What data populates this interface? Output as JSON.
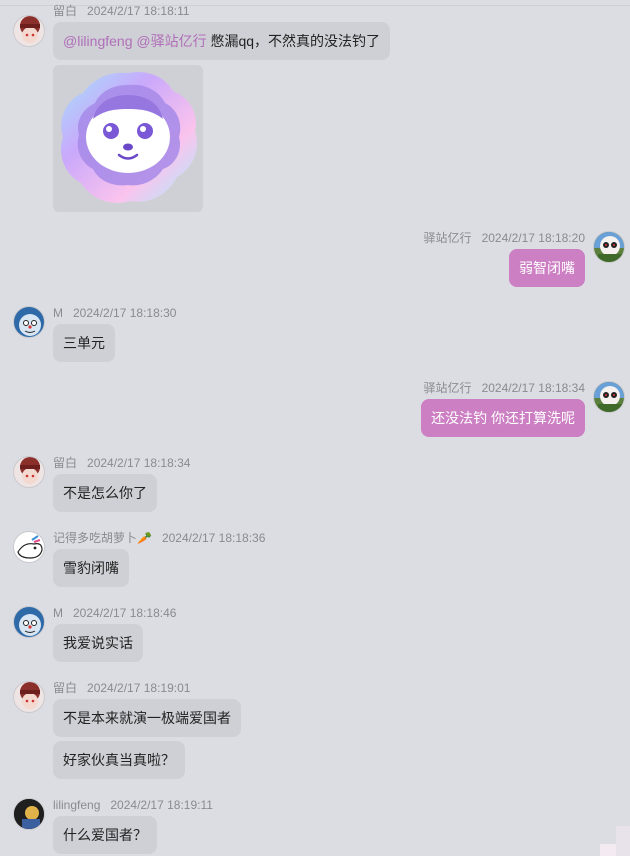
{
  "messages": [
    {
      "sender": "留白",
      "time": "2024/2/17 18:18:11",
      "mention": "@lilingfeng @驿站亿行",
      "text": "憋漏qq，不然真的没法钓了",
      "sticker": "dog-sticker"
    },
    {
      "sender": "驿站亿行",
      "time": "2024/2/17 18:18:20",
      "text": "弱智闭嘴"
    },
    {
      "sender": "M",
      "time": "2024/2/17 18:18:30",
      "text": "三单元"
    },
    {
      "sender": "驿站亿行",
      "time": "2024/2/17 18:18:34",
      "text": "还没法钓 你还打算洗呢"
    },
    {
      "sender": "留白",
      "time": "2024/2/17 18:18:34",
      "text": "不是怎么你了"
    },
    {
      "sender": "记得多吃胡萝卜🥕",
      "time": "2024/2/17 18:18:36",
      "text": "雪豹闭嘴"
    },
    {
      "sender": "M",
      "time": "2024/2/17 18:18:46",
      "text": "我爱说实话"
    },
    {
      "sender": "留白",
      "time": "2024/2/17 18:19:01",
      "text": "不是本来就演一极端爱国者",
      "text2": "好家伙真当真啦？"
    },
    {
      "sender": "lilingfeng",
      "time": "2024/2/17 18:19:11",
      "text": "什么爱国者？"
    }
  ],
  "colors": {
    "background": "#dcdde2",
    "left_bubble": "#cfd0d5",
    "right_bubble": "#cc7fc3",
    "mention": "#b06fb9"
  }
}
